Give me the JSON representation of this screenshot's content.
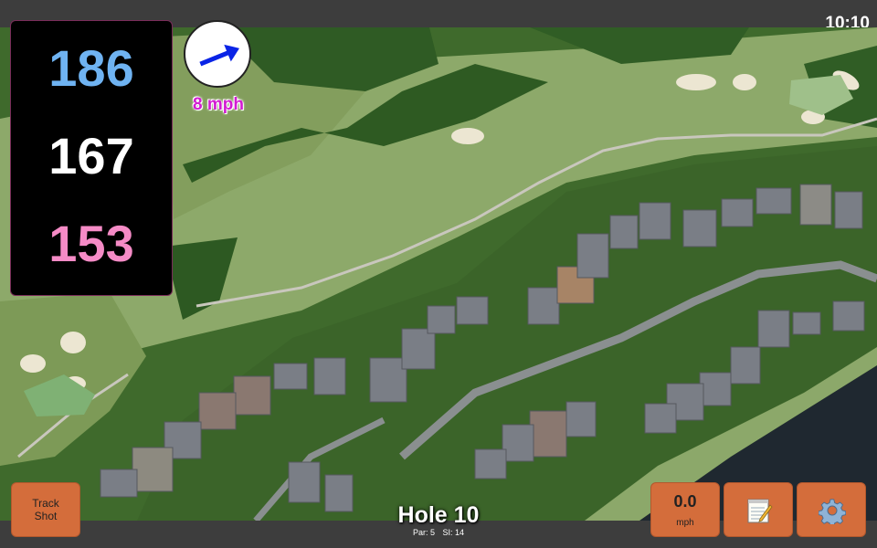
{
  "status": {
    "time": "10:10"
  },
  "distances": {
    "back": "186",
    "center": "167",
    "front": "153"
  },
  "wind": {
    "speed": "8 mph",
    "direction_icon": "arrow-east-northeast-icon"
  },
  "hole": {
    "title": "Hole 10",
    "par": "Par: 5",
    "stroke_index": "SI: 14"
  },
  "buttons": {
    "track_shot_line1": "Track",
    "track_shot_line2": "Shot",
    "speed_value": "0.0",
    "speed_unit": "mph",
    "notes_icon": "notepad-icon",
    "settings_icon": "gear-icon"
  },
  "colors": {
    "back_distance": "#6fb3f2",
    "center_distance": "#ffffff",
    "front_distance": "#f58bc6",
    "wind_text": "#d21bd2",
    "button_orange": "#d46d3b"
  }
}
